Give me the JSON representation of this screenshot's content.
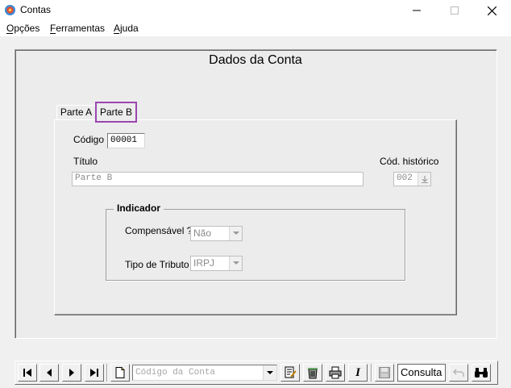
{
  "window": {
    "title": "Contas"
  },
  "menu": [
    {
      "label": "Opções"
    },
    {
      "label": "Ferramentas"
    },
    {
      "label": "Ajuda"
    }
  ],
  "form": {
    "title": "Dados da Conta",
    "tabs": [
      {
        "label": "Parte A"
      },
      {
        "label": "Parte B"
      }
    ],
    "codigo": {
      "label": "Código",
      "value": "00001"
    },
    "titulo": {
      "label": "Título",
      "value": "Parte B"
    },
    "cod_historico": {
      "label": "Cód. histórico",
      "value": "002"
    },
    "indicador": {
      "title": "Indicador",
      "compensavel": {
        "label": "Compensável ?",
        "value": "Não"
      },
      "tipo_tributo": {
        "label": "Tipo de Tributo",
        "value": "IRPJ"
      }
    }
  },
  "toolbar": {
    "codigo_conta_placeholder": "Código da Conta",
    "mode": "Consulta"
  },
  "colors": {
    "selected_tab_outline": "#9b46b0"
  }
}
